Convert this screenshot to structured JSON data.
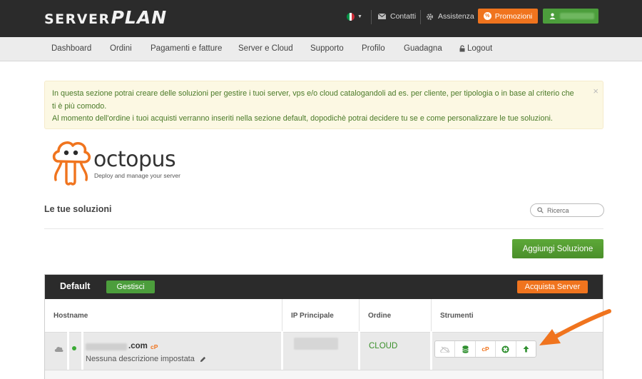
{
  "brand": {
    "part1": "SERVER",
    "part2": "PLAN"
  },
  "header": {
    "flag_colors": [
      "#009246",
      "#ffffff",
      "#ce2b37"
    ],
    "contact": "Contatti",
    "support": "Assistenza",
    "promo_button": "Promozioni",
    "promo_icon_text": "%",
    "user_icon": "user-icon"
  },
  "nav": {
    "items": [
      "Dashboard",
      "Ordini",
      "Pagamenti e fatture",
      "Server e Cloud",
      "Supporto",
      "Profilo",
      "Guadagna",
      "Logout"
    ]
  },
  "alert": {
    "line1": "In questa sezione potrai creare delle soluzioni per gestire i tuoi server, vps e/o cloud catalogandoli ad es. per cliente, per tipologia o in base al criterio che ti è più comodo.",
    "line2": "Al momento dell'ordine i tuoi acquisti verranno inseriti nella sezione default, dopodichè potrai decidere tu se e come personalizzare le tue soluzioni.",
    "close": "×"
  },
  "octopus": {
    "name": "octopus",
    "tagline": "Deploy and manage your server"
  },
  "solutions": {
    "title": "Le tue soluzioni",
    "search_placeholder": "Ricerca",
    "add_button": "Aggiungi Soluzione"
  },
  "panel": {
    "title": "Default",
    "manage_button": "Gestisci",
    "buy_button": "Acquista Server",
    "columns": [
      "Hostname",
      "IP Principale",
      "Ordine",
      "Strumenti"
    ],
    "rows": [
      {
        "hostname_suffix": ".com",
        "cp_badge": "cP",
        "description": "Nessuna descrizione impostata",
        "order": "CLOUD",
        "status_color": "#3aaa35"
      }
    ],
    "tools": [
      "cloud-off-icon",
      "database-icon",
      "cpanel-icon",
      "lifebuoy-icon",
      "upgrade-arrow-icon"
    ],
    "tools_cp": "cP"
  },
  "colors": {
    "orange": "#f0741e",
    "green": "#4c9e3c",
    "dark": "#2b2b2b"
  }
}
